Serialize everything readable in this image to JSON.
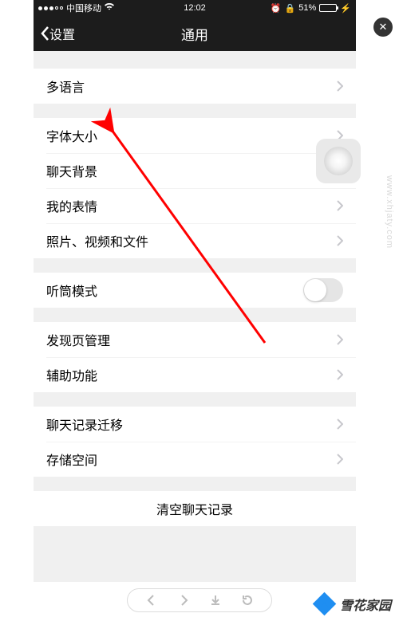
{
  "statusBar": {
    "carrier": "中国移动",
    "time": "12:02",
    "batteryText": "51%"
  },
  "nav": {
    "back": "设置",
    "title": "通用"
  },
  "groups": [
    {
      "cells": [
        {
          "label": "多语言",
          "type": "disclosure"
        }
      ]
    },
    {
      "cells": [
        {
          "label": "字体大小",
          "type": "disclosure"
        },
        {
          "label": "聊天背景",
          "type": "disclosure"
        },
        {
          "label": "我的表情",
          "type": "disclosure"
        },
        {
          "label": "照片、视频和文件",
          "type": "disclosure"
        }
      ]
    },
    {
      "cells": [
        {
          "label": "听筒模式",
          "type": "switch",
          "on": false
        }
      ]
    },
    {
      "cells": [
        {
          "label": "发现页管理",
          "type": "disclosure"
        },
        {
          "label": "辅助功能",
          "type": "disclosure"
        }
      ]
    },
    {
      "cells": [
        {
          "label": "聊天记录迁移",
          "type": "disclosure"
        },
        {
          "label": "存储空间",
          "type": "disclosure"
        }
      ]
    },
    {
      "cells": [
        {
          "label": "清空聊天记录",
          "type": "button"
        }
      ]
    }
  ],
  "watermark": {
    "side": "www.xhjaty.com",
    "brand": "雪花家园"
  },
  "annotation": {
    "color": "#ff0000"
  }
}
